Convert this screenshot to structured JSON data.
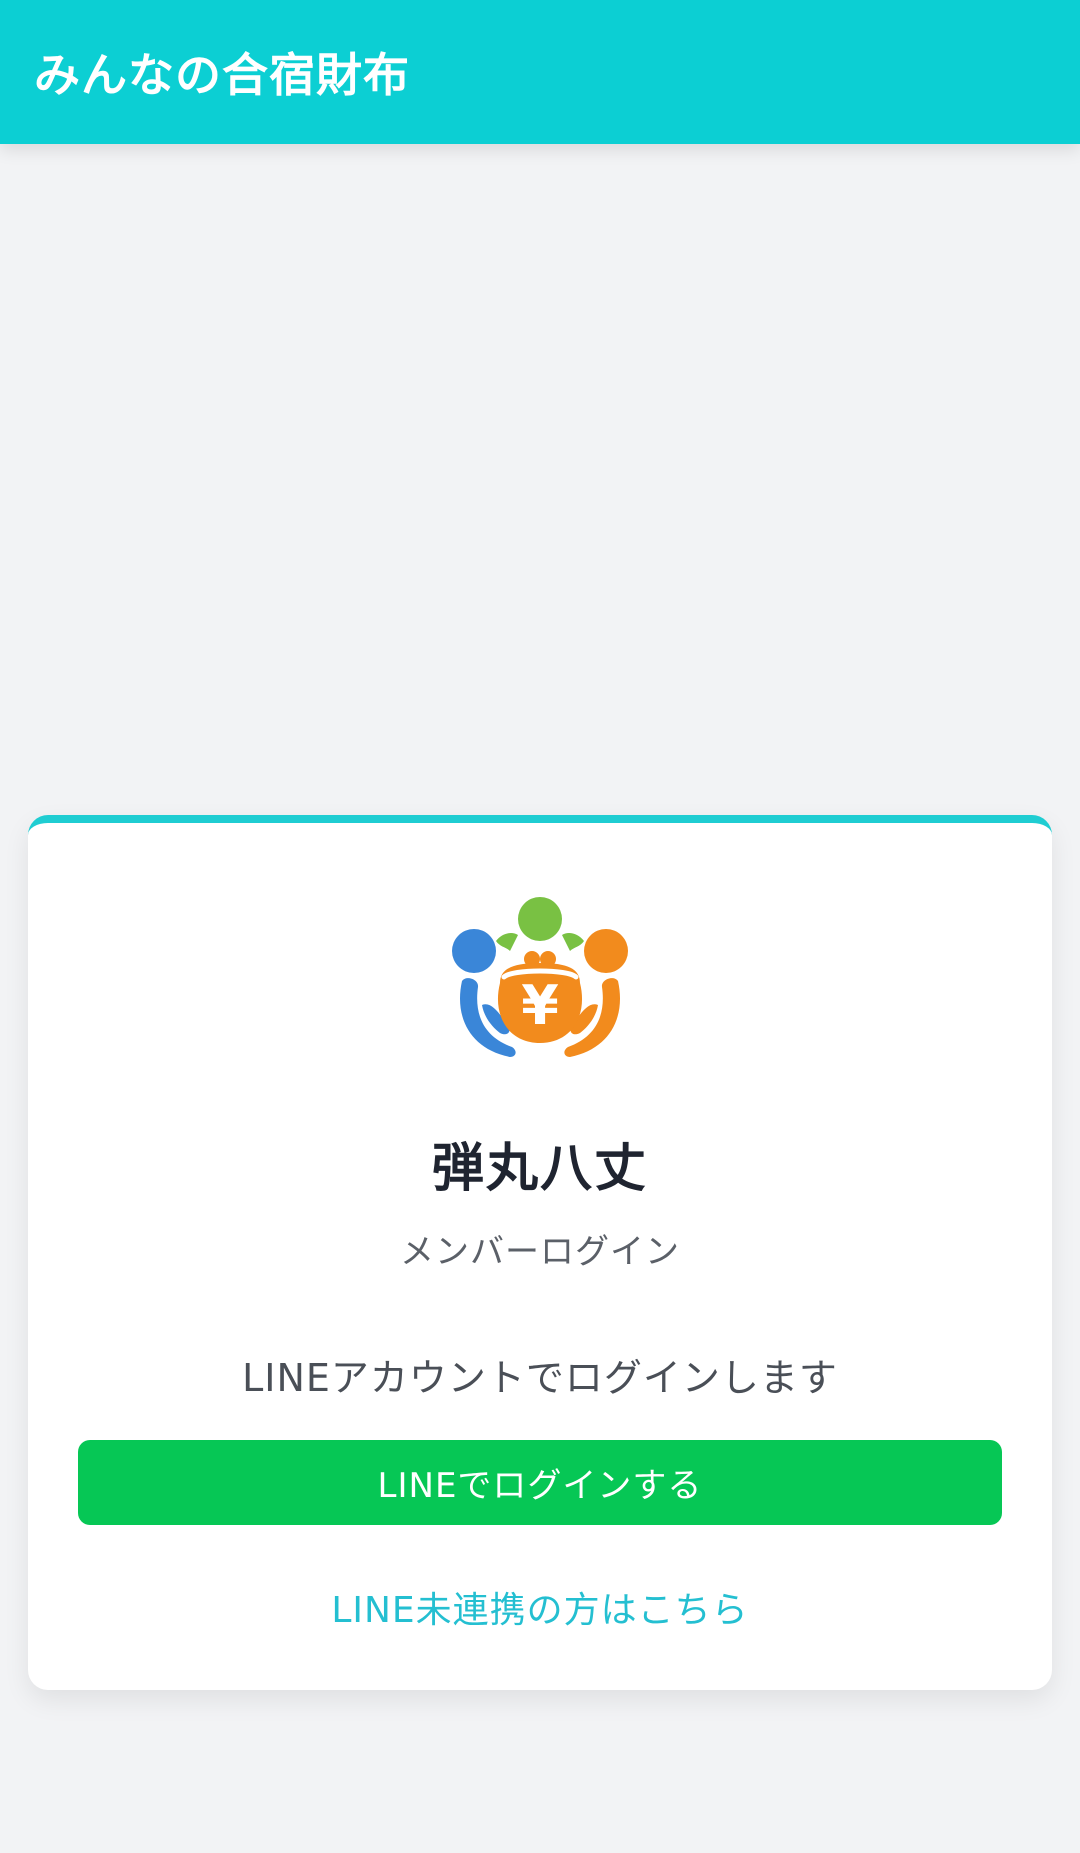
{
  "header": {
    "title": "みんなの合宿財布"
  },
  "card": {
    "logo_icon": "shared-wallet-yen-icon",
    "logo_symbol": "¥",
    "group_name": "弾丸八丈",
    "subtitle": "メンバーログイン",
    "description": "LINEアカウントでログインします",
    "login_button_label": "LINEでログインする",
    "unlinked_link_label": "LINE未連携の方はこちら"
  },
  "colors": {
    "header_bg": "#0ccfd3",
    "card_accent": "#1fcdd2",
    "line_green": "#06c755",
    "link_color": "#24bfd1"
  }
}
